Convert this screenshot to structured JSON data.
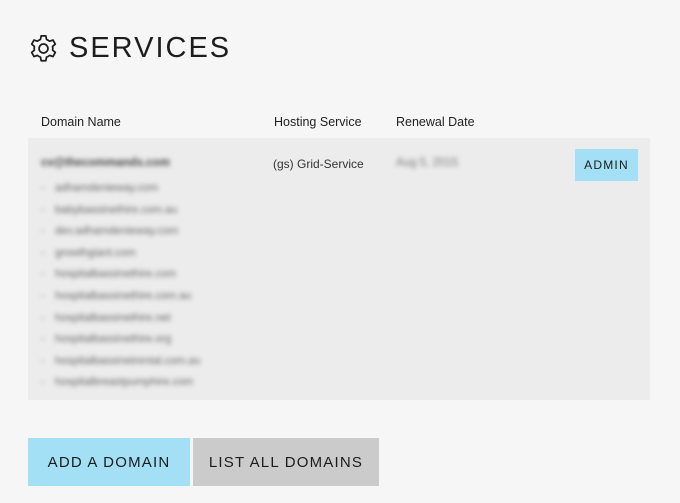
{
  "page": {
    "title": "SERVICES",
    "icon": "gear-icon"
  },
  "table": {
    "headers": {
      "domain_name": "Domain Name",
      "hosting_service": "Hosting Service",
      "renewal_date": "Renewal Date"
    },
    "rows": [
      {
        "account": "cv@thecommands.com",
        "hosting_service": "(gs) Grid-Service",
        "renewal_date": "Aug 5, 2015",
        "admin_label": "ADMIN",
        "domains": [
          "adhamdenieway.com",
          "babybassinethire.com.au",
          "dev.adhamdenieway.com",
          "growthgiant.com",
          "hospitalbassinethire.com",
          "hospitalbassinethire.com.au",
          "hospitalbassinethire.net",
          "hospitalbassinethire.org",
          "hospitalbassinetrental.com.au",
          "hospitalbreastpumphire.com"
        ]
      }
    ]
  },
  "actions": {
    "add_domain": "ADD A DOMAIN",
    "list_domains": "LIST ALL DOMAINS"
  },
  "colors": {
    "accent": "#a3e0f5",
    "secondary_button": "#cbcbcb",
    "row_background": "#ececec",
    "page_background": "#f6f6f6"
  }
}
